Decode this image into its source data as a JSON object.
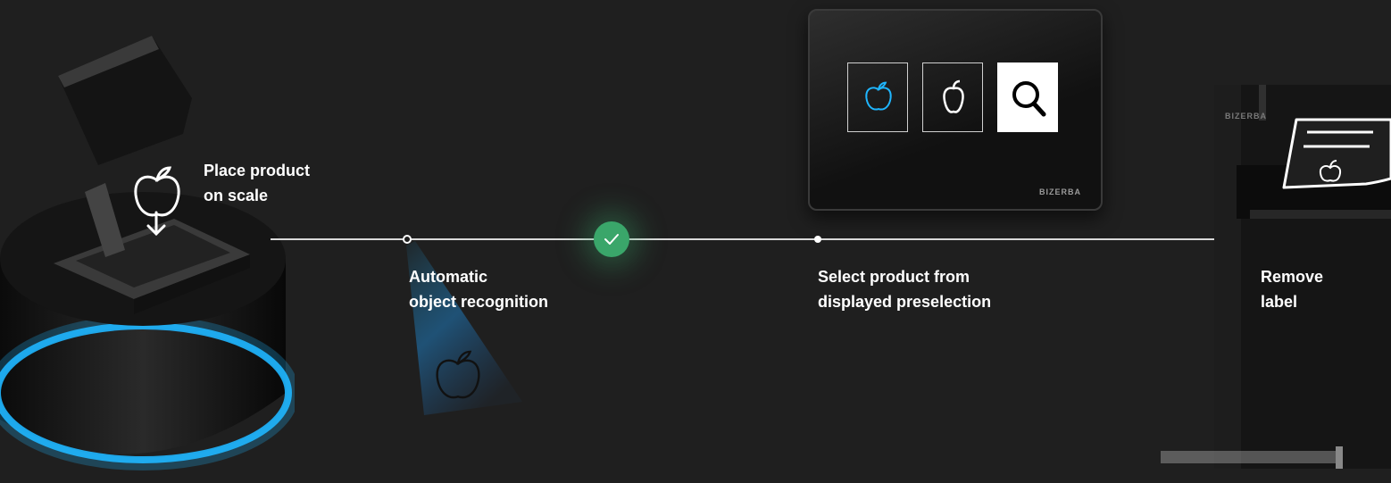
{
  "steps": [
    {
      "label": "Place product\non scale"
    },
    {
      "label": "Automatic\nobject recognition"
    },
    {
      "label": "Select product from\ndisplayed preselection"
    },
    {
      "label": "Remove\nlabel"
    }
  ],
  "screen": {
    "brand": "BIZERBA"
  },
  "printer": {
    "brand": "BIZERBA"
  },
  "colors": {
    "background": "#1f1f1f",
    "success": "#3aa66a",
    "glow": "#1fb6ff"
  }
}
